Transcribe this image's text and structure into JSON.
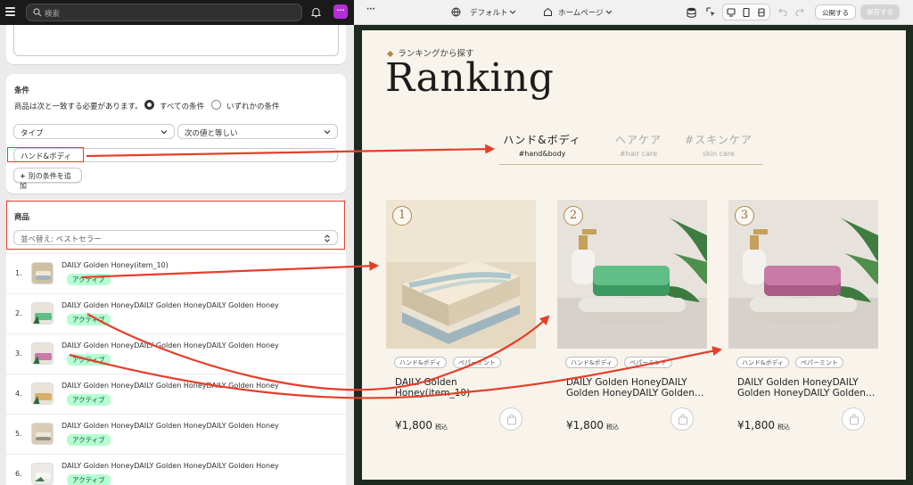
{
  "admin": {
    "search_placeholder": "検索",
    "avatar_label": "···",
    "conditions": {
      "heading": "条件",
      "match_description": "商品は次と一致する必要があります。",
      "option_all": "すべての条件",
      "option_any": "いずれかの条件",
      "field_select": "タイプ",
      "operator_select": "次の値と等しい",
      "value_input": "ハンド&ボディ",
      "add_condition_label": "別の条件を追加"
    },
    "products": {
      "heading": "商品",
      "sort_select": "並べ替え: ベストセラー",
      "items": [
        {
          "num": "1.",
          "title": "DAILY Golden Honey(item_10)",
          "status": "アクティブ"
        },
        {
          "num": "2.",
          "title": "DAILY Golden HoneyDAILY Golden HoneyDAILY Golden Honey",
          "status": "アクティブ"
        },
        {
          "num": "3.",
          "title": "DAILY Golden HoneyDAILY Golden HoneyDAILY Golden Honey",
          "status": "アクティブ"
        },
        {
          "num": "4.",
          "title": "DAILY Golden HoneyDAILY Golden HoneyDAILY Golden Honey",
          "status": "アクティブ"
        },
        {
          "num": "5.",
          "title": "DAILY Golden HoneyDAILY Golden HoneyDAILY Golden Honey",
          "status": "アクティブ"
        },
        {
          "num": "6.",
          "title": "DAILY Golden HoneyDAILY Golden HoneyDAILY Golden Honey",
          "status": "アクティブ"
        }
      ]
    }
  },
  "editor": {
    "more_label": "···",
    "theme_select": "デフォルト",
    "page_select": "ホームページ",
    "publish_label": "公開する",
    "save_label": "保存する"
  },
  "storefront": {
    "eyebrow": "ランキングから探す",
    "title": "Ranking",
    "tabs": [
      {
        "label": "ハンド&ボディ",
        "sub": "#hand&body",
        "active": true
      },
      {
        "label": "ヘアケア",
        "sub": "#hair care",
        "active": false
      },
      {
        "label": "#スキンケア",
        "sub": "skin care",
        "active": false
      }
    ],
    "products": [
      {
        "rank": "1",
        "tags": [
          "ハンド&ボディ",
          "ペパーミント"
        ],
        "title": "DAILY Golden Honey(item_10)",
        "price": "¥1,800",
        "tax": "税込",
        "soap_color": "#e8dcc4"
      },
      {
        "rank": "2",
        "tags": [
          "ハンド&ボディ",
          "ペパーミント"
        ],
        "title": "DAILY Golden HoneyDAILY Golden HoneyDAILY Golden…",
        "price": "¥1,800",
        "tax": "税込",
        "soap_color": "#5fbf86"
      },
      {
        "rank": "3",
        "tags": [
          "ハンド&ボディ",
          "ペパーミント"
        ],
        "title": "DAILY Golden HoneyDAILY Golden HoneyDAILY Golden…",
        "price": "¥1,800",
        "tax": "税込",
        "soap_color": "#c97aa6"
      }
    ]
  },
  "colors": {
    "annotation_red": "#e53f2a",
    "badge_green": "#b4fed2",
    "page_bg": "#f8f4ec",
    "accent_gold": "#b48a3a"
  }
}
